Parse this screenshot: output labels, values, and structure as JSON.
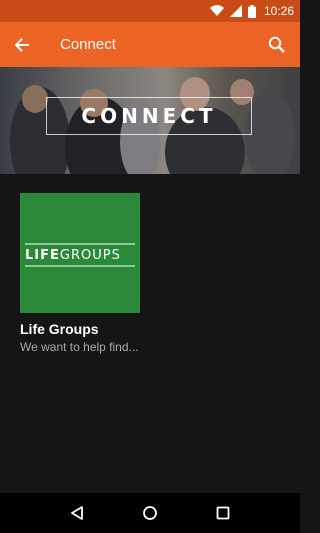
{
  "status_bar": {
    "time": "10:26"
  },
  "app_bar": {
    "title": "Connect",
    "back_icon": "arrow-back-icon",
    "search_icon": "search-icon"
  },
  "hero": {
    "title": "CONNECT"
  },
  "cards": [
    {
      "thumb_text_bold": "LIFE",
      "thumb_text_light": "GROUPS",
      "title": "Life Groups",
      "subtitle": "We want to help find..."
    }
  ],
  "nav_bar": {
    "back_icon": "nav-back-icon",
    "home_icon": "nav-home-icon",
    "recents_icon": "nav-recents-icon"
  },
  "colors": {
    "status_bar": "#c94c17",
    "app_bar": "#ec6425",
    "background": "#151517",
    "card_green": "#2a8a3a"
  }
}
